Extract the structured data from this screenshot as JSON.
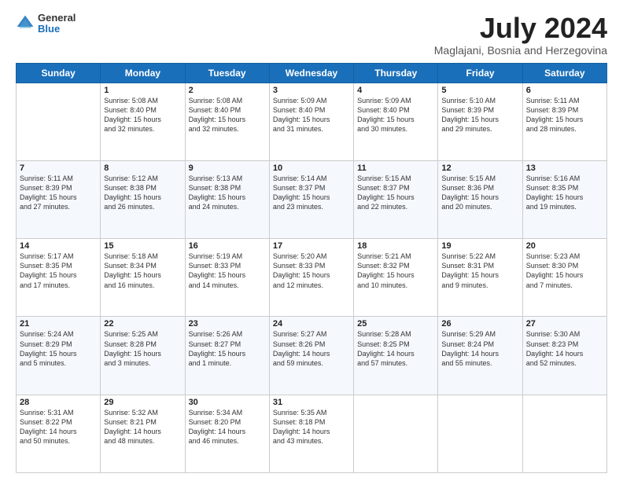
{
  "logo": {
    "general": "General",
    "blue": "Blue"
  },
  "title": "July 2024",
  "location": "Maglajani, Bosnia and Herzegovina",
  "days": [
    "Sunday",
    "Monday",
    "Tuesday",
    "Wednesday",
    "Thursday",
    "Friday",
    "Saturday"
  ],
  "weeks": [
    [
      {
        "day": "",
        "info": ""
      },
      {
        "day": "1",
        "info": "Sunrise: 5:08 AM\nSunset: 8:40 PM\nDaylight: 15 hours\nand 32 minutes."
      },
      {
        "day": "2",
        "info": "Sunrise: 5:08 AM\nSunset: 8:40 PM\nDaylight: 15 hours\nand 32 minutes."
      },
      {
        "day": "3",
        "info": "Sunrise: 5:09 AM\nSunset: 8:40 PM\nDaylight: 15 hours\nand 31 minutes."
      },
      {
        "day": "4",
        "info": "Sunrise: 5:09 AM\nSunset: 8:40 PM\nDaylight: 15 hours\nand 30 minutes."
      },
      {
        "day": "5",
        "info": "Sunrise: 5:10 AM\nSunset: 8:39 PM\nDaylight: 15 hours\nand 29 minutes."
      },
      {
        "day": "6",
        "info": "Sunrise: 5:11 AM\nSunset: 8:39 PM\nDaylight: 15 hours\nand 28 minutes."
      }
    ],
    [
      {
        "day": "7",
        "info": "Sunrise: 5:11 AM\nSunset: 8:39 PM\nDaylight: 15 hours\nand 27 minutes."
      },
      {
        "day": "8",
        "info": "Sunrise: 5:12 AM\nSunset: 8:38 PM\nDaylight: 15 hours\nand 26 minutes."
      },
      {
        "day": "9",
        "info": "Sunrise: 5:13 AM\nSunset: 8:38 PM\nDaylight: 15 hours\nand 24 minutes."
      },
      {
        "day": "10",
        "info": "Sunrise: 5:14 AM\nSunset: 8:37 PM\nDaylight: 15 hours\nand 23 minutes."
      },
      {
        "day": "11",
        "info": "Sunrise: 5:15 AM\nSunset: 8:37 PM\nDaylight: 15 hours\nand 22 minutes."
      },
      {
        "day": "12",
        "info": "Sunrise: 5:15 AM\nSunset: 8:36 PM\nDaylight: 15 hours\nand 20 minutes."
      },
      {
        "day": "13",
        "info": "Sunrise: 5:16 AM\nSunset: 8:35 PM\nDaylight: 15 hours\nand 19 minutes."
      }
    ],
    [
      {
        "day": "14",
        "info": "Sunrise: 5:17 AM\nSunset: 8:35 PM\nDaylight: 15 hours\nand 17 minutes."
      },
      {
        "day": "15",
        "info": "Sunrise: 5:18 AM\nSunset: 8:34 PM\nDaylight: 15 hours\nand 16 minutes."
      },
      {
        "day": "16",
        "info": "Sunrise: 5:19 AM\nSunset: 8:33 PM\nDaylight: 15 hours\nand 14 minutes."
      },
      {
        "day": "17",
        "info": "Sunrise: 5:20 AM\nSunset: 8:33 PM\nDaylight: 15 hours\nand 12 minutes."
      },
      {
        "day": "18",
        "info": "Sunrise: 5:21 AM\nSunset: 8:32 PM\nDaylight: 15 hours\nand 10 minutes."
      },
      {
        "day": "19",
        "info": "Sunrise: 5:22 AM\nSunset: 8:31 PM\nDaylight: 15 hours\nand 9 minutes."
      },
      {
        "day": "20",
        "info": "Sunrise: 5:23 AM\nSunset: 8:30 PM\nDaylight: 15 hours\nand 7 minutes."
      }
    ],
    [
      {
        "day": "21",
        "info": "Sunrise: 5:24 AM\nSunset: 8:29 PM\nDaylight: 15 hours\nand 5 minutes."
      },
      {
        "day": "22",
        "info": "Sunrise: 5:25 AM\nSunset: 8:28 PM\nDaylight: 15 hours\nand 3 minutes."
      },
      {
        "day": "23",
        "info": "Sunrise: 5:26 AM\nSunset: 8:27 PM\nDaylight: 15 hours\nand 1 minute."
      },
      {
        "day": "24",
        "info": "Sunrise: 5:27 AM\nSunset: 8:26 PM\nDaylight: 14 hours\nand 59 minutes."
      },
      {
        "day": "25",
        "info": "Sunrise: 5:28 AM\nSunset: 8:25 PM\nDaylight: 14 hours\nand 57 minutes."
      },
      {
        "day": "26",
        "info": "Sunrise: 5:29 AM\nSunset: 8:24 PM\nDaylight: 14 hours\nand 55 minutes."
      },
      {
        "day": "27",
        "info": "Sunrise: 5:30 AM\nSunset: 8:23 PM\nDaylight: 14 hours\nand 52 minutes."
      }
    ],
    [
      {
        "day": "28",
        "info": "Sunrise: 5:31 AM\nSunset: 8:22 PM\nDaylight: 14 hours\nand 50 minutes."
      },
      {
        "day": "29",
        "info": "Sunrise: 5:32 AM\nSunset: 8:21 PM\nDaylight: 14 hours\nand 48 minutes."
      },
      {
        "day": "30",
        "info": "Sunrise: 5:34 AM\nSunset: 8:20 PM\nDaylight: 14 hours\nand 46 minutes."
      },
      {
        "day": "31",
        "info": "Sunrise: 5:35 AM\nSunset: 8:18 PM\nDaylight: 14 hours\nand 43 minutes."
      },
      {
        "day": "",
        "info": ""
      },
      {
        "day": "",
        "info": ""
      },
      {
        "day": "",
        "info": ""
      }
    ]
  ]
}
